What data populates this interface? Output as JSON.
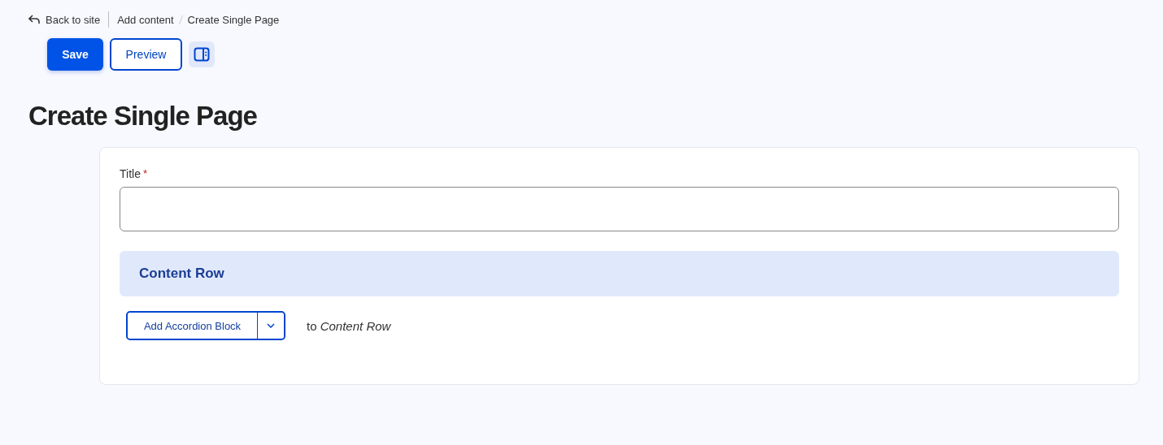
{
  "breadcrumb": {
    "back": "Back to site",
    "items": [
      "Add content",
      "Create Single Page"
    ]
  },
  "actions": {
    "save": "Save",
    "preview": "Preview"
  },
  "heading": "Create Single Page",
  "form": {
    "title_label": "Title",
    "required_mark": "*",
    "section": "Content Row",
    "add_button": "Add Accordion Block",
    "add_target": "to *Content Row*"
  }
}
